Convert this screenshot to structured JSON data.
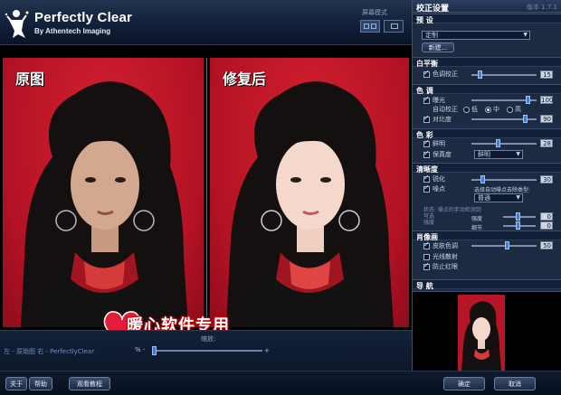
{
  "header": {
    "title": "Perfectly Clear",
    "subtitle": "By Athentech Imaging",
    "view_mode_label": "屏幕模式"
  },
  "images": {
    "original_label": "原图",
    "corrected_label": "修复后",
    "watermark_text": "暖心软件专用"
  },
  "zoom": {
    "title": "缩放:",
    "footer_left": "左 - 原始图   右 - PerfectlyClear",
    "percent_label": "% -",
    "end_label": "+",
    "level": 0.0
  },
  "bottom_buttons": {
    "about": "关于",
    "help": "帮助",
    "tutorial": "观看教程",
    "ok": "确定",
    "cancel": "取消"
  },
  "panel": {
    "title": "校正设置",
    "version": "版本 1.7.1",
    "preset": {
      "heading": "预  设",
      "selected": "定制",
      "new_button": "新建..."
    },
    "balance": {
      "heading": "白平衡",
      "items": [
        {
          "label": "色调校正",
          "checked": true,
          "value": "15",
          "level": 0.1
        }
      ]
    },
    "tone": {
      "heading": "色  调",
      "exposure": {
        "label": "曝光",
        "checked": true,
        "value": "100",
        "level": 0.9
      },
      "auto": {
        "label": "自动校正",
        "options": [
          "低",
          "中",
          "高"
        ],
        "selected": 1
      },
      "contrast": {
        "label": "对比度",
        "checked": true,
        "value": "90",
        "level": 0.85
      }
    },
    "color": {
      "heading": "色  彩",
      "vibrancy": {
        "label": "鲜明",
        "checked": true,
        "value": "28",
        "level": 0.4
      },
      "fidelity": {
        "label": "保真度",
        "checked": true,
        "select": "鲜明"
      }
    },
    "sharpness": {
      "heading": "清晰度",
      "sharpen": {
        "label": "锐化",
        "checked": true,
        "value": "30",
        "level": 0.15
      },
      "noise": {
        "label": "噪点",
        "checked": true,
        "hint": "选择自动噪点去除类型:",
        "select": "普通"
      },
      "manual_title": "状态: 噪点的手动检测到",
      "manual_left": "可选\n强度",
      "strength_label": "强度",
      "strength_value": "0",
      "detail_label": "细节",
      "detail_value": "0"
    },
    "portrait": {
      "heading": "肖像画",
      "skin": {
        "label": "皮肤色调",
        "checked": true,
        "value": "50",
        "level": 0.55
      },
      "light": {
        "label": "光线散射",
        "checked": false
      },
      "redeye": {
        "label": "防止红眼",
        "checked": true
      }
    },
    "navigator": {
      "heading": "导  航"
    }
  }
}
